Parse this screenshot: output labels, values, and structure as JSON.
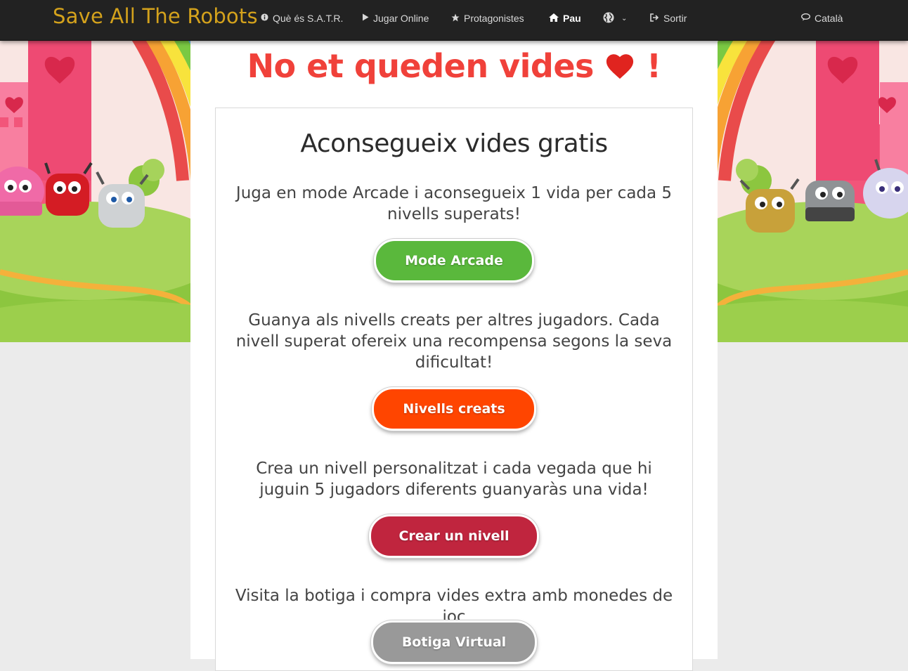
{
  "nav": {
    "brand": "Save All The Robots",
    "items": [
      {
        "icon": "info-icon",
        "label": "Què és S.A.T.R."
      },
      {
        "icon": "play-icon",
        "label": "Jugar Online"
      },
      {
        "icon": "star-icon",
        "label": "Protagonistes"
      },
      {
        "icon": "home-icon",
        "label": "Pau"
      },
      {
        "icon": "globe-icon",
        "label": ""
      },
      {
        "icon": "sign-out-icon",
        "label": "Sortir"
      },
      {
        "icon": "chat-icon",
        "label": "Català"
      }
    ]
  },
  "page": {
    "title": "No et queden vides",
    "title_suffix": "!"
  },
  "panel": {
    "title": "Aconsegueix vides gratis",
    "sections": [
      {
        "text": "Juga en mode Arcade i aconsegueix 1 vida per cada 5 nivells superats!",
        "button": "Mode Arcade",
        "color": "#5ab83c"
      },
      {
        "text": "Guanya als nivells creats per altres jugadors. Cada nivell superat ofereix una recompensa segons la seva dificultat!",
        "button": "Nivells creats",
        "color": "#ff4500"
      },
      {
        "text": "Crea un nivell personalitzat i cada vegada que hi juguin 5 jugadors diferents guanyaràs una vida!",
        "button": "Crear un nivell",
        "color": "#c0253e"
      },
      {
        "text": "Visita la botiga i compra vides extra amb monedes de joc",
        "button": "Botiga Virtual",
        "color": "#999999"
      }
    ]
  },
  "colors": {
    "brand": "#d4a21c",
    "title": "#f0413a",
    "navbar": "#222222"
  }
}
